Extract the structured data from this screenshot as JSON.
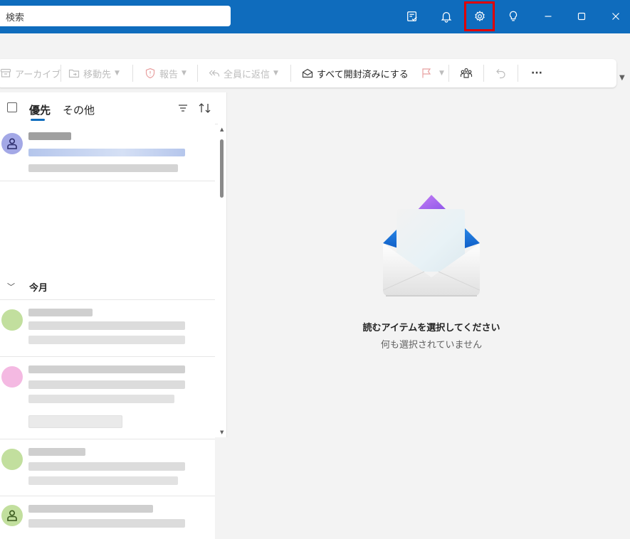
{
  "titlebar": {
    "search_placeholder": "検索",
    "icons": [
      "tasks-icon",
      "bell-icon",
      "gear-icon",
      "lightbulb-icon"
    ],
    "window_controls": [
      "minimize-icon",
      "maximize-icon",
      "close-icon"
    ],
    "highlight_color": "#e00000",
    "brand_color": "#0f6cbd"
  },
  "ribbon": {
    "archive": "アーカイブ",
    "move_to": "移動先",
    "report": "報告",
    "reply_all": "全員に返信",
    "mark_all_read": "すべて開封済みにする",
    "more": "···"
  },
  "list": {
    "tab_focused": "優先",
    "tab_other": "その他",
    "group_label": "今月"
  },
  "reading": {
    "empty_title": "読むアイテムを選択してください",
    "empty_subtitle": "何も選択されていません"
  }
}
